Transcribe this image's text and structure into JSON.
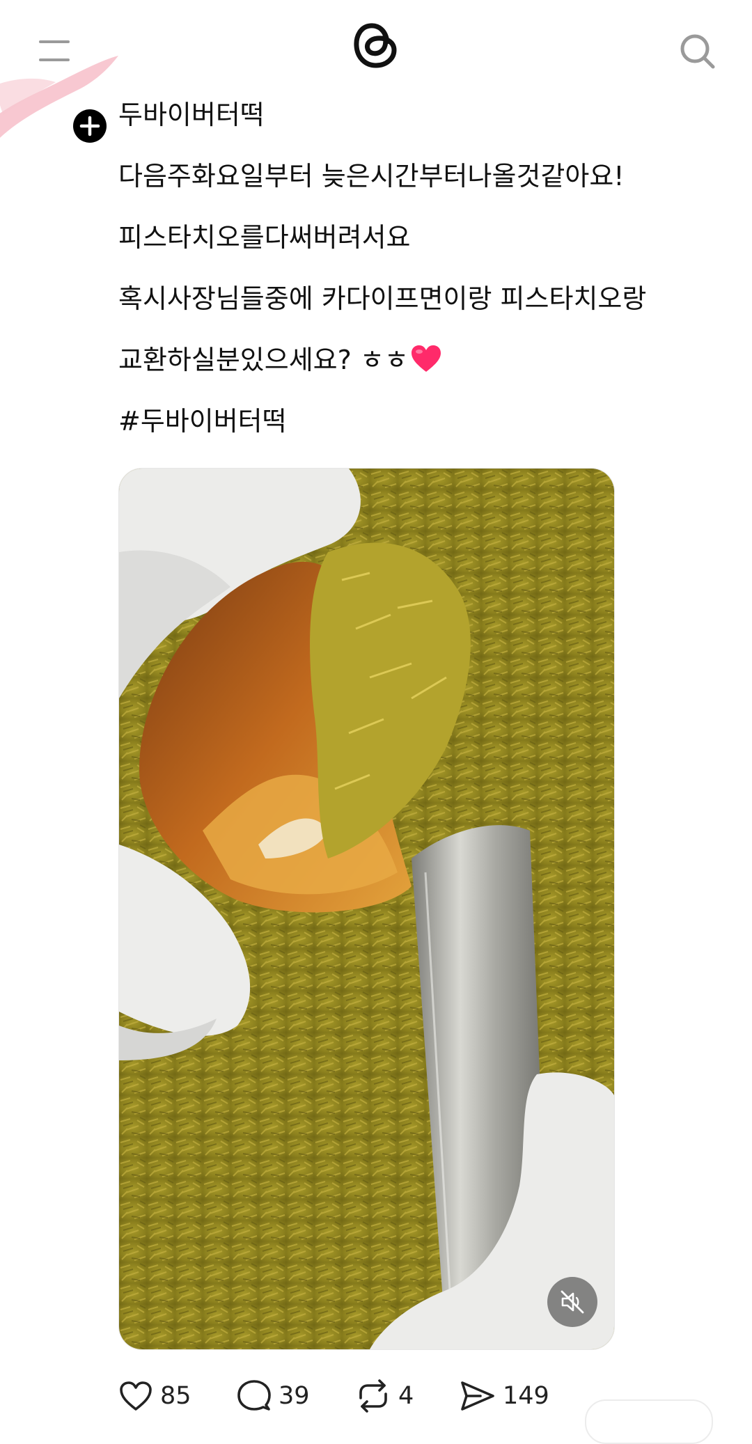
{
  "icons": {
    "menu": "menu-icon",
    "logo": "threads-logo",
    "search": "search-icon",
    "follow": "plus-icon",
    "mute": "muted-speaker-icon",
    "like": "heart-icon",
    "comment": "comment-icon",
    "repost": "repost-icon",
    "share": "send-icon"
  },
  "post": {
    "author": "두바이버터떡",
    "lines": [
      "다음주화요일부터 늦은시간부터나올것같아요!",
      "피스타치오를다써버려서요",
      "혹시사장님들중에 카다이프면이랑 피스타치오랑",
      "교환하실분있으세요? ㅎㅎ",
      "#두바이버터떡"
    ],
    "emoji": "heart"
  },
  "actions": {
    "likes": "85",
    "comments": "39",
    "reposts": "4",
    "shares": "149"
  },
  "colors": {
    "text": "#111111",
    "icon": "#9a9a9a",
    "heart": "#ff2a6a",
    "smudge": "#f5b6c2"
  }
}
